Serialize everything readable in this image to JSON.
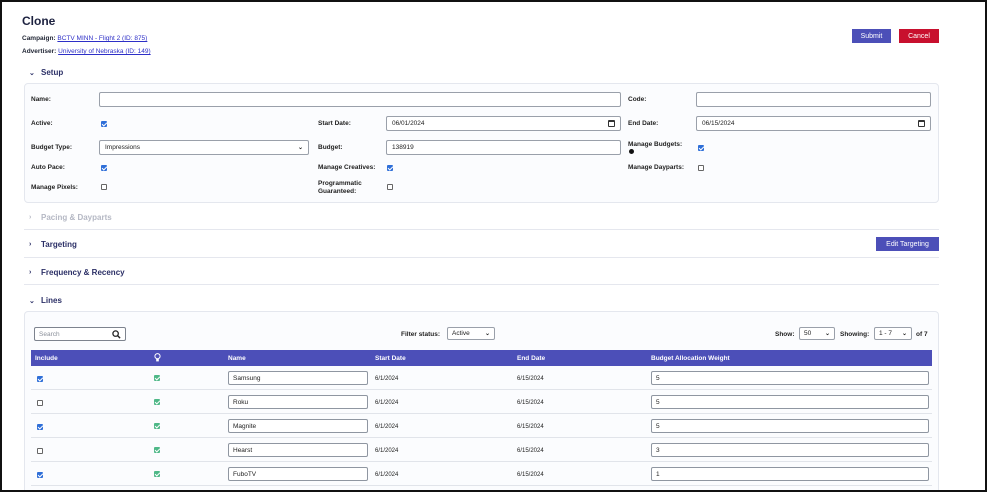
{
  "header": {
    "title": "Clone",
    "campaign_label": "Campaign:",
    "campaign_link": "BCTV MINN - Flight 2 (ID: 875)",
    "advertiser_label": "Advertiser:",
    "advertiser_link": "University of Nebraska (ID: 149)",
    "submit_label": "Submit",
    "cancel_label": "Cancel"
  },
  "sections": {
    "setup": "Setup",
    "pacing": "Pacing & Dayparts",
    "targeting": "Targeting",
    "edit_targeting": "Edit Targeting",
    "frequency": "Frequency & Recency",
    "lines": "Lines"
  },
  "setup": {
    "name_label": "Name:",
    "name_value": "",
    "code_label": "Code:",
    "code_value": "",
    "active_label": "Active:",
    "active": true,
    "start_date_label": "Start Date:",
    "start_date": "06/01/2024",
    "end_date_label": "End Date:",
    "end_date": "06/15/2024",
    "budget_type_label": "Budget Type:",
    "budget_type": "Impressions",
    "budget_label": "Budget:",
    "budget": "138919",
    "manage_budgets_label": "Manage Budgets:",
    "manage_budgets": true,
    "auto_pace_label": "Auto Pace:",
    "auto_pace": true,
    "manage_creatives_label": "Manage Creatives:",
    "manage_creatives": true,
    "manage_dayparts_label": "Manage Dayparts:",
    "manage_dayparts": false,
    "manage_pixels_label": "Manage Pixels:",
    "manage_pixels": false,
    "prog_guaranteed_label_1": "Programmatic",
    "prog_guaranteed_label_2": "Guaranteed:",
    "prog_guaranteed": false
  },
  "lines": {
    "search_placeholder": "Search",
    "filter_label": "Filter status:",
    "filter_value": "Active",
    "show_label": "Show:",
    "show_value": "50",
    "showing_label": "Showing:",
    "showing_value": "1 - 7",
    "of_total": "of 7",
    "columns": [
      "Include",
      "",
      "Name",
      "Start Date",
      "End Date",
      "Budget Allocation Weight"
    ],
    "rows": [
      {
        "include": true,
        "flag": true,
        "name": "Samsung",
        "start": "6/1/2024",
        "end": "6/15/2024",
        "weight": "5"
      },
      {
        "include": false,
        "flag": true,
        "name": "Roku",
        "start": "6/1/2024",
        "end": "6/15/2024",
        "weight": "5"
      },
      {
        "include": true,
        "flag": true,
        "name": "Magnite",
        "start": "6/1/2024",
        "end": "6/15/2024",
        "weight": "5"
      },
      {
        "include": false,
        "flag": true,
        "name": "Hearst",
        "start": "6/1/2024",
        "end": "6/15/2024",
        "weight": "3"
      },
      {
        "include": true,
        "flag": true,
        "name": "FuboTV",
        "start": "6/1/2024",
        "end": "6/15/2024",
        "weight": "1"
      }
    ]
  },
  "colors": {
    "primary": "#4c4fb8",
    "danger": "#c8102e",
    "checkbox": "#2f6fd8",
    "green_check": "#4fb888"
  }
}
